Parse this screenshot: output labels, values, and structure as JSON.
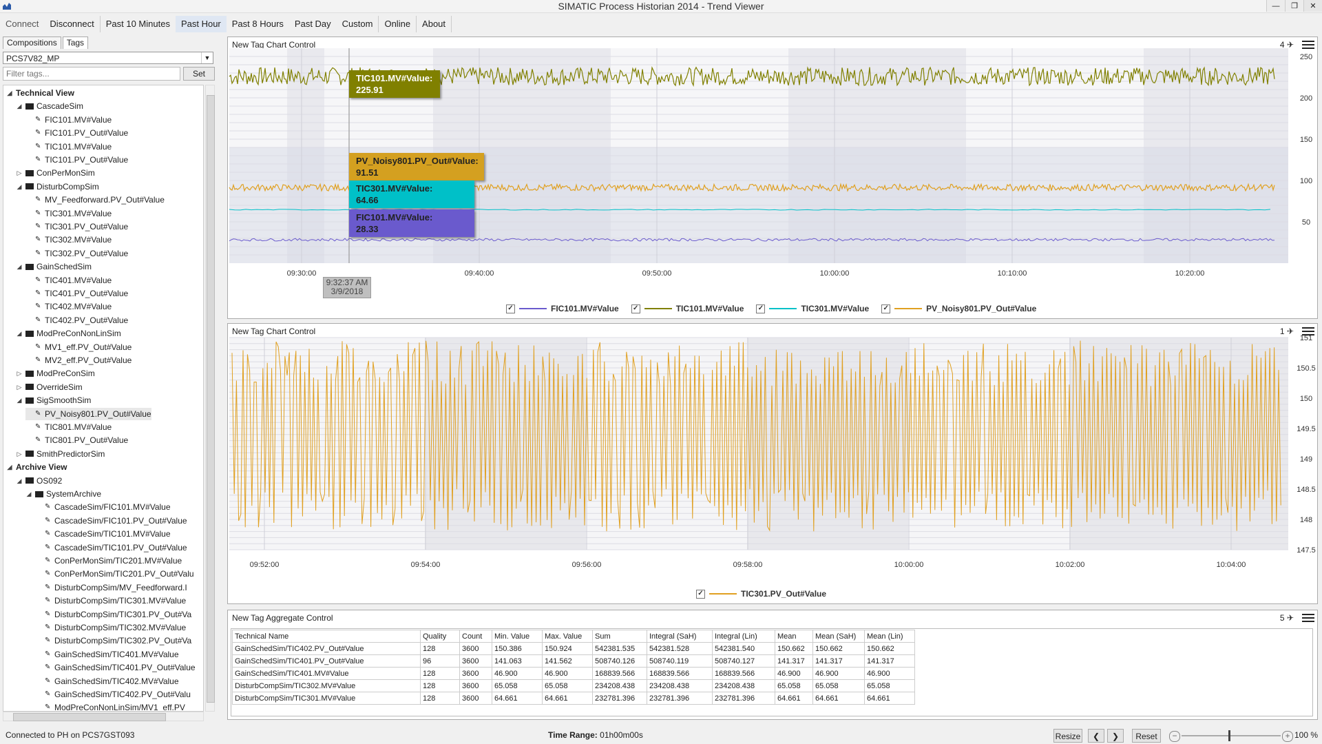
{
  "window": {
    "title": "SIMATIC Process Historian 2014 - Trend Viewer"
  },
  "toolbar": {
    "connect": "Connect",
    "disconnect": "Disconnect",
    "past10": "Past 10 Minutes",
    "pasthour": "Past Hour",
    "past8": "Past 8 Hours",
    "pastday": "Past Day",
    "custom": "Custom",
    "online": "Online",
    "about": "About"
  },
  "left": {
    "tabs": [
      "Compositions",
      "Tags"
    ],
    "dropdown": "PCS7V82_MP",
    "filter_placeholder": "Filter tags...",
    "set": "Set",
    "tree": [
      {
        "label": "Technical View",
        "level": 0,
        "kind": "section",
        "exp": "open"
      },
      {
        "label": "CascadeSim",
        "level": 1,
        "kind": "folder",
        "exp": "open"
      },
      {
        "label": "FIC101.MV#Value",
        "level": 2,
        "kind": "tag"
      },
      {
        "label": "FIC101.PV_Out#Value",
        "level": 2,
        "kind": "tag"
      },
      {
        "label": "TIC101.MV#Value",
        "level": 2,
        "kind": "tag"
      },
      {
        "label": "TIC101.PV_Out#Value",
        "level": 2,
        "kind": "tag"
      },
      {
        "label": "ConPerMonSim",
        "level": 1,
        "kind": "folder",
        "exp": "closed"
      },
      {
        "label": "DisturbCompSim",
        "level": 1,
        "kind": "folder",
        "exp": "open"
      },
      {
        "label": "MV_Feedforward.PV_Out#Value",
        "level": 2,
        "kind": "tag"
      },
      {
        "label": "TIC301.MV#Value",
        "level": 2,
        "kind": "tag"
      },
      {
        "label": "TIC301.PV_Out#Value",
        "level": 2,
        "kind": "tag"
      },
      {
        "label": "TIC302.MV#Value",
        "level": 2,
        "kind": "tag"
      },
      {
        "label": "TIC302.PV_Out#Value",
        "level": 2,
        "kind": "tag"
      },
      {
        "label": "GainSchedSim",
        "level": 1,
        "kind": "folder",
        "exp": "open"
      },
      {
        "label": "TIC401.MV#Value",
        "level": 2,
        "kind": "tag"
      },
      {
        "label": "TIC401.PV_Out#Value",
        "level": 2,
        "kind": "tag"
      },
      {
        "label": "TIC402.MV#Value",
        "level": 2,
        "kind": "tag"
      },
      {
        "label": "TIC402.PV_Out#Value",
        "level": 2,
        "kind": "tag"
      },
      {
        "label": "ModPreConNonLinSim",
        "level": 1,
        "kind": "folder",
        "exp": "open"
      },
      {
        "label": "MV1_eff.PV_Out#Value",
        "level": 2,
        "kind": "tag"
      },
      {
        "label": "MV2_eff.PV_Out#Value",
        "level": 2,
        "kind": "tag"
      },
      {
        "label": "ModPreConSim",
        "level": 1,
        "kind": "folder",
        "exp": "closed"
      },
      {
        "label": "OverrideSim",
        "level": 1,
        "kind": "folder",
        "exp": "closed"
      },
      {
        "label": "SigSmoothSim",
        "level": 1,
        "kind": "folder",
        "exp": "open"
      },
      {
        "label": "PV_Noisy801.PV_Out#Value",
        "level": 2,
        "kind": "tag",
        "sel": true
      },
      {
        "label": "TIC801.MV#Value",
        "level": 2,
        "kind": "tag"
      },
      {
        "label": "TIC801.PV_Out#Value",
        "level": 2,
        "kind": "tag"
      },
      {
        "label": "SmithPredictorSim",
        "level": 1,
        "kind": "folder",
        "exp": "closed"
      },
      {
        "label": "Archive View",
        "level": 0,
        "kind": "section",
        "exp": "open"
      },
      {
        "label": "OS092",
        "level": 1,
        "kind": "folder",
        "exp": "open"
      },
      {
        "label": "SystemArchive",
        "level": 2,
        "kind": "folder",
        "exp": "open"
      },
      {
        "label": "CascadeSim/FIC101.MV#Value",
        "level": 3,
        "kind": "tag"
      },
      {
        "label": "CascadeSim/FIC101.PV_Out#Value",
        "level": 3,
        "kind": "tag"
      },
      {
        "label": "CascadeSim/TIC101.MV#Value",
        "level": 3,
        "kind": "tag"
      },
      {
        "label": "CascadeSim/TIC101.PV_Out#Value",
        "level": 3,
        "kind": "tag"
      },
      {
        "label": "ConPerMonSim/TIC201.MV#Value",
        "level": 3,
        "kind": "tag"
      },
      {
        "label": "ConPerMonSim/TIC201.PV_Out#Valu",
        "level": 3,
        "kind": "tag"
      },
      {
        "label": "DisturbCompSim/MV_Feedforward.I",
        "level": 3,
        "kind": "tag"
      },
      {
        "label": "DisturbCompSim/TIC301.MV#Value",
        "level": 3,
        "kind": "tag"
      },
      {
        "label": "DisturbCompSim/TIC301.PV_Out#Va",
        "level": 3,
        "kind": "tag"
      },
      {
        "label": "DisturbCompSim/TIC302.MV#Value",
        "level": 3,
        "kind": "tag"
      },
      {
        "label": "DisturbCompSim/TIC302.PV_Out#Va",
        "level": 3,
        "kind": "tag"
      },
      {
        "label": "GainSchedSim/TIC401.MV#Value",
        "level": 3,
        "kind": "tag"
      },
      {
        "label": "GainSchedSim/TIC401.PV_Out#Value",
        "level": 3,
        "kind": "tag"
      },
      {
        "label": "GainSchedSim/TIC402.MV#Value",
        "level": 3,
        "kind": "tag"
      },
      {
        "label": "GainSchedSim/TIC402.PV_Out#Valu",
        "level": 3,
        "kind": "tag"
      },
      {
        "label": "ModPreConNonLinSim/MV1_eff.PV_",
        "level": 3,
        "kind": "tag"
      }
    ]
  },
  "chart1": {
    "title": "New Tag Chart Control",
    "count": "4",
    "x_ticks": [
      "09:30:00",
      "09:40:00",
      "09:50:00",
      "10:00:00",
      "10:10:00",
      "10:20:00"
    ],
    "y_ticks": [
      "250",
      "200",
      "150",
      "100",
      "50"
    ],
    "cursor_time": "9:32:37 AM",
    "cursor_date": "3/9/2018",
    "tooltips": [
      {
        "name": "TIC101.MV#Value:",
        "value": "225.91",
        "color": "#808000"
      },
      {
        "name": "PV_Noisy801.PV_Out#Value:",
        "value": "91.51",
        "color": "#D4A020"
      },
      {
        "name": "TIC301.MV#Value:",
        "value": "64.66",
        "color": "#00C0C8"
      },
      {
        "name": "FIC101.MV#Value:",
        "value": "28.33",
        "color": "#6A5ACD"
      }
    ],
    "legend": [
      {
        "name": "FIC101.MV#Value",
        "color": "#6A5ACD"
      },
      {
        "name": "TIC101.MV#Value",
        "color": "#808000"
      },
      {
        "name": "TIC301.MV#Value",
        "color": "#00C0C8"
      },
      {
        "name": "PV_Noisy801.PV_Out#Value",
        "color": "#E0A020"
      }
    ]
  },
  "chart2": {
    "title": "New Tag Chart Control",
    "count": "1",
    "x_ticks": [
      "09:52:00",
      "09:54:00",
      "09:56:00",
      "09:58:00",
      "10:00:00",
      "10:02:00",
      "10:04:00"
    ],
    "y_ticks": [
      "151",
      "150.5",
      "150",
      "149.5",
      "149",
      "148.5",
      "148",
      "147.5"
    ],
    "legend": [
      {
        "name": "TIC301.PV_Out#Value",
        "color": "#E0A020"
      }
    ]
  },
  "chart_data": [
    {
      "type": "line",
      "x": [
        "09:30:00",
        "09:40:00",
        "09:50:00",
        "10:00:00",
        "10:10:00",
        "10:20:00"
      ],
      "ylim": [
        0,
        260
      ],
      "series": [
        {
          "name": "TIC101.MV#Value",
          "values": [
            226,
            226,
            226,
            226,
            226,
            226
          ]
        },
        {
          "name": "PV_Noisy801.PV_Out#Value",
          "values": [
            91.5,
            91.5,
            91.5,
            91.5,
            91.5,
            91.5
          ]
        },
        {
          "name": "TIC301.MV#Value",
          "values": [
            64.66,
            64.66,
            64.66,
            64.66,
            64.66,
            64.66
          ]
        },
        {
          "name": "FIC101.MV#Value",
          "values": [
            28.33,
            28.33,
            28.33,
            28.33,
            28.33,
            28.33
          ]
        }
      ]
    },
    {
      "type": "line",
      "x": [
        "09:52:00",
        "09:54:00",
        "09:56:00",
        "09:58:00",
        "10:00:00",
        "10:02:00",
        "10:04:00"
      ],
      "ylim": [
        147.5,
        151
      ],
      "series": [
        {
          "name": "TIC301.PV_Out#Value",
          "values": [
            148,
            150.8,
            147.9,
            150.9,
            148.1,
            150.8,
            148.2
          ]
        }
      ]
    }
  ],
  "aggregate": {
    "title": "New Tag Aggregate Control",
    "count": "5",
    "headers": [
      "Technical Name",
      "Quality",
      "Count",
      "Min. Value",
      "Max. Value",
      "Sum",
      "Integral (SaH)",
      "Integral (Lin)",
      "Mean",
      "Mean (SaH)",
      "Mean (Lin)"
    ],
    "rows": [
      [
        "GainSchedSim/TIC402.PV_Out#Value",
        "128",
        "3600",
        "150.386",
        "150.924",
        "542381.535",
        "542381.528",
        "542381.540",
        "150.662",
        "150.662",
        "150.662"
      ],
      [
        "GainSchedSim/TIC401.PV_Out#Value",
        "96",
        "3600",
        "141.063",
        "141.562",
        "508740.126",
        "508740.119",
        "508740.127",
        "141.317",
        "141.317",
        "141.317"
      ],
      [
        "GainSchedSim/TIC401.MV#Value",
        "128",
        "3600",
        "46.900",
        "46.900",
        "168839.566",
        "168839.566",
        "168839.566",
        "46.900",
        "46.900",
        "46.900"
      ],
      [
        "DisturbCompSim/TIC302.MV#Value",
        "128",
        "3600",
        "65.058",
        "65.058",
        "234208.438",
        "234208.438",
        "234208.438",
        "65.058",
        "65.058",
        "65.058"
      ],
      [
        "DisturbCompSim/TIC301.MV#Value",
        "128",
        "3600",
        "64.661",
        "64.661",
        "232781.396",
        "232781.396",
        "232781.396",
        "64.661",
        "64.661",
        "64.661"
      ]
    ]
  },
  "status": {
    "connection": "Connected to PH on PCS7GST093",
    "time_range_label": "Time Range:",
    "time_range": "01h00m00s",
    "resize": "Resize",
    "reset": "Reset",
    "zoom": "100 %"
  }
}
